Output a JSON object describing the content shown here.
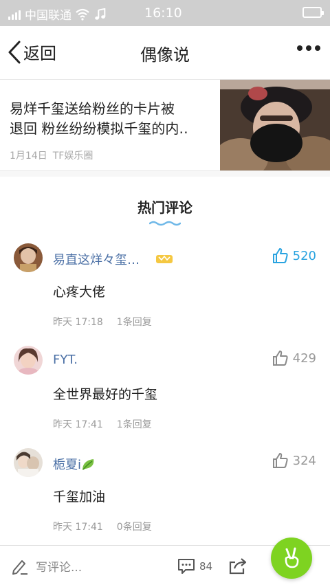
{
  "status_bar": {
    "carrier": "中国联通",
    "time": "16:10"
  },
  "nav": {
    "back_label": "返回",
    "title": "偶像说"
  },
  "article": {
    "title_line1": "易烊千玺送给粉丝的卡片被",
    "title_line2": "退回 粉丝纷纷模拟千玺的内‥",
    "date": "1月14日",
    "source": "TF娱乐圈"
  },
  "hot_comments": {
    "title": "热门评论",
    "accent_color": "#6fb8e8",
    "items": [
      {
        "username": "易直这烊々玺…",
        "text": "心疼大佬",
        "time": "昨天 17:18",
        "replies": "1条回复",
        "likes": "520",
        "liked": true,
        "badge": "vip-crown-icon"
      },
      {
        "username": "FYT.",
        "text": "全世界最好的千玺",
        "time": "昨天 17:41",
        "replies": "1条回复",
        "likes": "429",
        "liked": false
      },
      {
        "username": "栀夏i",
        "text": "千玺加油",
        "time": "昨天 17:41",
        "replies": "0条回复",
        "likes": "324",
        "liked": false,
        "badge": "leaf-icon"
      }
    ]
  },
  "bottom_bar": {
    "write_placeholder": "写评论...",
    "comment_count": "84"
  },
  "colors": {
    "like_active": "#29a3e0",
    "username": "#4a6fa5",
    "fab": "#7ed321",
    "status_bar": "#cfcfcf"
  }
}
